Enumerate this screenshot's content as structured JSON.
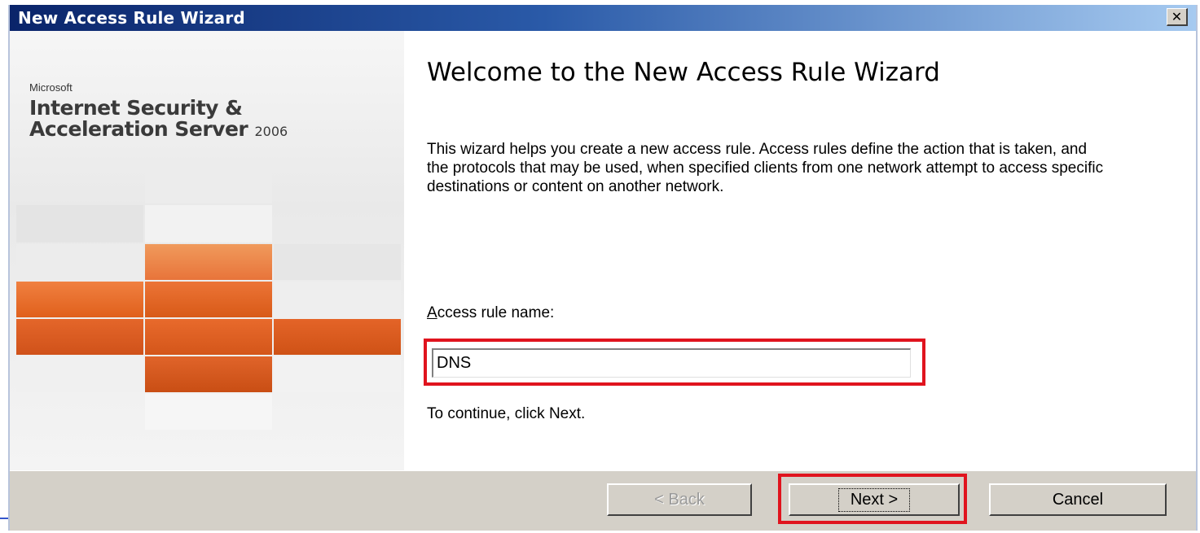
{
  "window": {
    "title": "New Access Rule Wizard",
    "close_icon": "close-icon"
  },
  "brand": {
    "company": "Microsoft",
    "line1": "Internet Security &",
    "line2": "Acceleration Server",
    "year": "2006",
    "accent_color": "#e8601c"
  },
  "main": {
    "heading": "Welcome to the New Access Rule Wizard",
    "description": "This wizard helps you create a new access rule. Access rules define the action that is taken, and the protocols that may be used, when specified clients from one network attempt to access specific destinations or content on another network.",
    "name_label_accel": "A",
    "name_label_rest": "ccess rule name:",
    "name_value": "DNS",
    "continue_text": "To continue, click Next."
  },
  "footer": {
    "back_label": "< Back",
    "next_label": "Next >",
    "cancel_label": "Cancel"
  },
  "highlight_color": "#e0141e"
}
